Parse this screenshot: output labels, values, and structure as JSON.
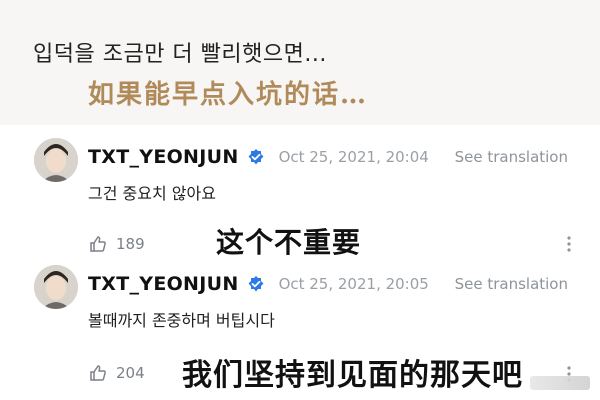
{
  "post": {
    "korean_text": "입덕을 조금만 더 빨리햇으면...",
    "chinese_caption": "如果能早点入坑的话…"
  },
  "comments": [
    {
      "username": "TXT_YEONJUN",
      "timestamp": "Oct 25, 2021, 20:04",
      "see_translation": "See translation",
      "text": "그건 중요치 않아요",
      "likes": "189",
      "chinese_caption": "这个不重要"
    },
    {
      "username": "TXT_YEONJUN",
      "timestamp": "Oct 25, 2021, 20:05",
      "see_translation": "See translation",
      "text": "볼때까지 존중하며 버팁시다",
      "likes": "204",
      "chinese_caption": "我们坚持到见面的那天吧"
    }
  ],
  "colors": {
    "verified": "#2c7be5",
    "chinese_caption_highlight": "#b08a59",
    "muted_text": "#9aa0a6"
  },
  "icons": {
    "verified": "verified-check-icon",
    "like": "thumbs-up-icon",
    "more": "more-vertical-icon"
  }
}
